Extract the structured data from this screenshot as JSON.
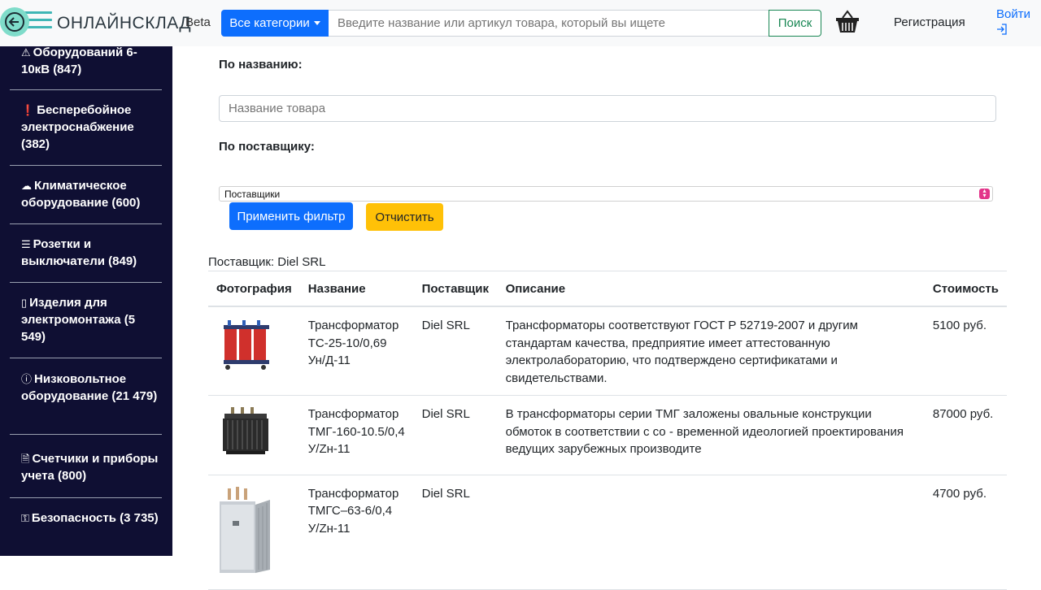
{
  "header": {
    "brand": "ОНЛАЙНСКЛАД",
    "beta": "Beta",
    "categories_button": "Все категории",
    "search_placeholder": "Введите название или артикул товара, который вы ищете",
    "search_button": "Поиск",
    "register": "Регистрация",
    "login": "Войти"
  },
  "sidebar": {
    "items": [
      {
        "icon": "warning-icon",
        "glyph": "⚠",
        "label": "Оборудований 6-10кВ (847)"
      },
      {
        "icon": "exclamation-box-icon",
        "glyph": "❗",
        "label": "Бесперебойное электроснабжение (382)"
      },
      {
        "icon": "climate-icon",
        "glyph": "☁",
        "label": "Климатическое оборудование (600)"
      },
      {
        "icon": "socket-icon",
        "glyph": "☰",
        "label": "Розетки и выключатели (849)"
      },
      {
        "icon": "box-icon",
        "glyph": "▯",
        "label": "Изделия для электромонтажа (5 549)"
      },
      {
        "icon": "info-circle-icon",
        "glyph": "ⓘ",
        "label": "Низковольтное оборудование (21 479)"
      },
      {
        "icon": "document-icon",
        "glyph": "🗎",
        "label": "Счетчики и приборы учета (800)"
      },
      {
        "icon": "key-icon",
        "glyph": "⚿",
        "label": "Безопасность (3 735)"
      }
    ]
  },
  "filter": {
    "by_name_label": "По названию:",
    "name_placeholder": "Название товара",
    "by_supplier_label": "По поставщику:",
    "supplier_select_value": "Поставщики",
    "apply_button": "Применить фильтр",
    "clear_button": "Отчистить"
  },
  "results": {
    "supplier_line": "Поставщик: Diel SRL",
    "columns": [
      "Фотография",
      "Название",
      "Поставщик",
      "Описание",
      "Стоимость"
    ],
    "rows": [
      {
        "name": "Трансформатор ТС-25-10/0,69 Ун/Д-11",
        "supplier": "Diel SRL",
        "description": "Трансформаторы соответствуют ГОСТ Р 52719-2007 и другим стандартам качества, предприятие имеет аттестованную электролабораторию, что подтверждено сертификатами и свидетельствами.",
        "price": "5100 руб."
      },
      {
        "name": "Трансформатор ТМГ-160-10.5/0,4 У/Zн-11",
        "supplier": "Diel SRL",
        "description": "В трансформаторы серии ТМГ заложены овальные конструкции обмоток в соответствии с со - временной идеологией проектирования ведущих зарубежных производите",
        "price": "87000 руб."
      },
      {
        "name": "Трансформатор ТМГС–63-6/0,4 У/Zн-11",
        "supplier": "Diel SRL",
        "description": "",
        "price": "4700 руб."
      }
    ]
  }
}
